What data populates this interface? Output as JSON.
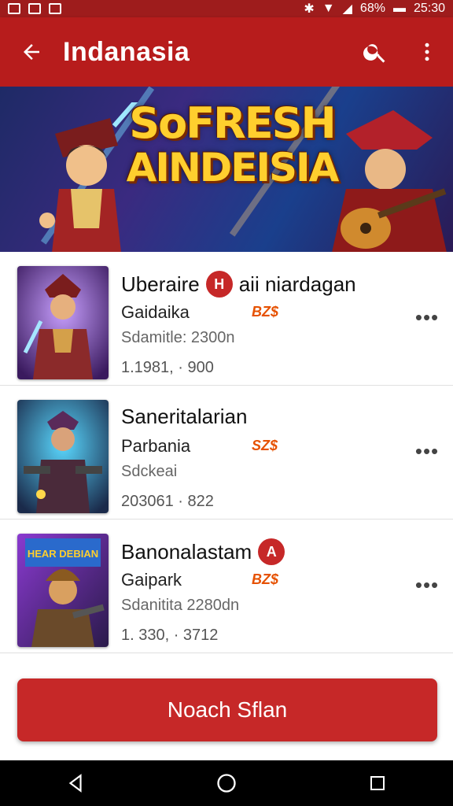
{
  "status": {
    "battery": "68%",
    "time": "25:30",
    "icons": [
      "notification-icon",
      "bluetooth-icon",
      "wifi-icon",
      "signal-icon",
      "battery-icon"
    ]
  },
  "appbar": {
    "title": "Indanasia",
    "back_icon": "arrow-back-icon",
    "search_icon": "search-icon",
    "more_icon": "more-vert-icon"
  },
  "banner": {
    "line1": "SoFRESH",
    "line2": "AINDEISIA"
  },
  "items": [
    {
      "name": "Uberaire",
      "name_suffix": "aii niardagan",
      "badge": "H",
      "subtitle": "Gaidaika",
      "tag": "BZ$",
      "desc": "Sdamitle: 2300n",
      "meta": "1.1981, · 900"
    },
    {
      "name": "Saneritalarian",
      "name_suffix": "",
      "badge": "",
      "subtitle": "Parbania",
      "tag": "SZ$",
      "desc": "Sdckeai",
      "meta": "203061 · 822"
    },
    {
      "name": "Banonalastam",
      "name_suffix": "",
      "badge": "A",
      "subtitle": "Gaipark",
      "tag": "BZ$",
      "desc": "Sdanitita 2280dn",
      "meta": "1. 330, · 3712"
    }
  ],
  "thumb_overlay": "HEAR DEBIAN",
  "cta": {
    "label": "Noach Sflan"
  },
  "colors": {
    "primary": "#b71c1c",
    "accent": "#c62828",
    "tag": "#e65100"
  }
}
